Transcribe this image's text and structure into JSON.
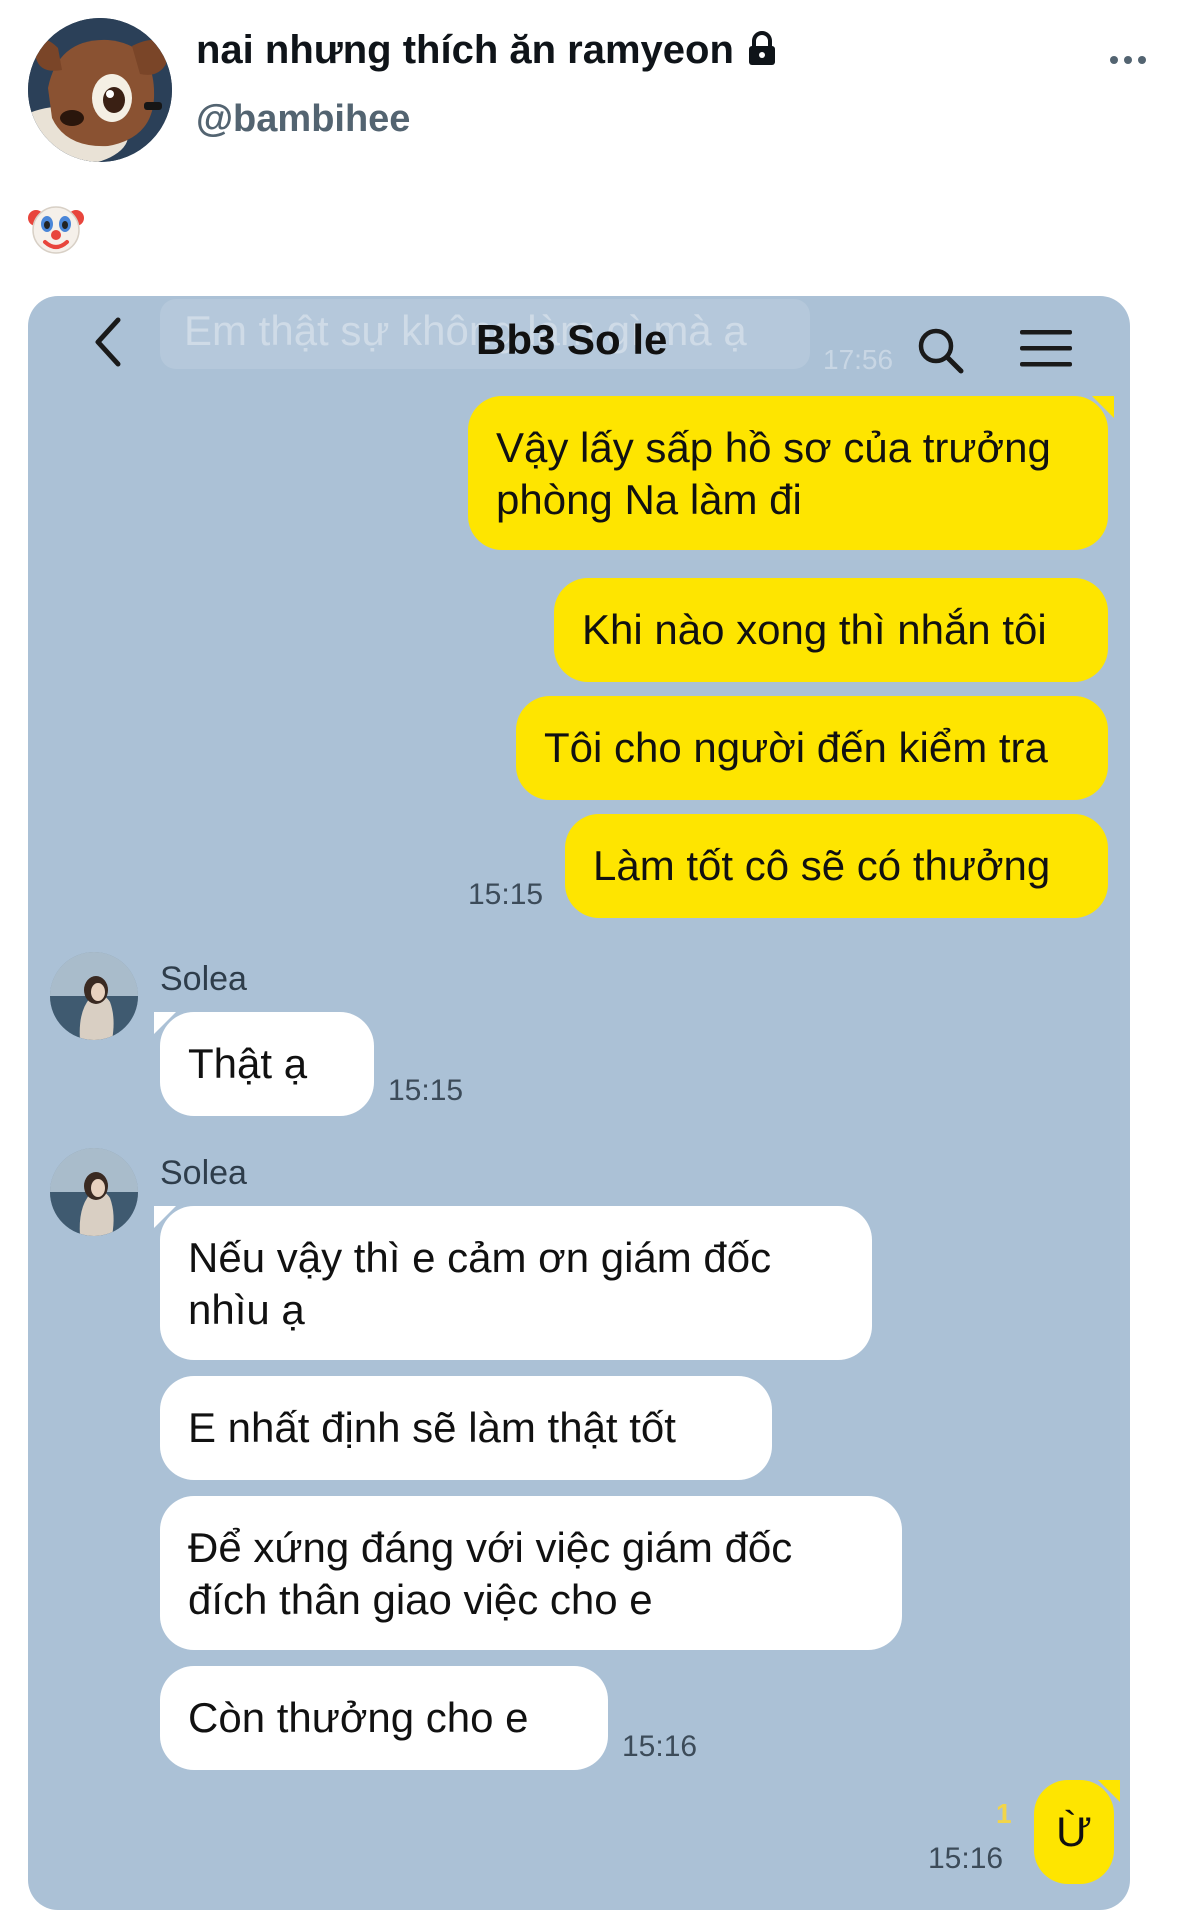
{
  "tweet": {
    "display_name": "nai nhưng thích ăn ramyeon",
    "handle": "@bambihee",
    "body_emoji": "clown-face"
  },
  "chat": {
    "faded_text": "Em thật sự không làm gì mà ạ",
    "faded_time": "17:56",
    "title": "Bb3 So le",
    "colors": {
      "background": "#abc1d6",
      "outgoing": "#fee500",
      "incoming": "#ffffff"
    },
    "outgoing_group": {
      "messages": [
        "Vậy lấy sấp hồ sơ của trưởng",
        "phòng Na làm đi",
        "Khi nào xong thì nhắn tôi",
        "Tôi cho người đến kiểm tra",
        "Làm tốt cô sẽ có thưởng"
      ],
      "time": "15:15"
    },
    "incoming_group_1": {
      "sender": "Solea",
      "messages": [
        "Thật ạ"
      ],
      "time": "15:15"
    },
    "incoming_group_2": {
      "sender": "Solea",
      "messages": [
        "Nếu vậy thì e cảm ơn giám đốc",
        "nhìu ạ",
        "E nhất định sẽ làm thật tốt",
        "Để xứng đáng với việc giám đốc",
        "đích thân giao việc cho e",
        "Còn thưởng cho e"
      ],
      "time": "15:16"
    },
    "last_reply": {
      "text": "Ừ",
      "unread": "1",
      "time": "15:16"
    }
  }
}
